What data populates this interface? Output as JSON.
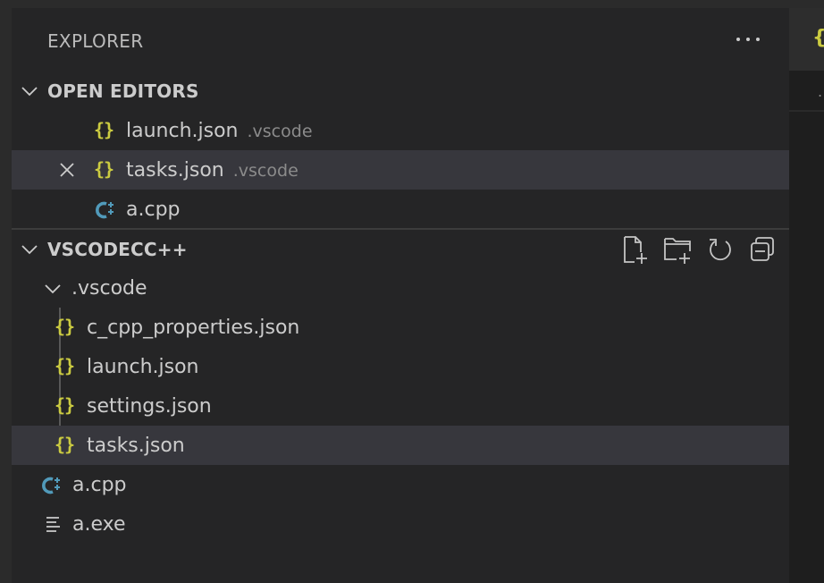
{
  "header": {
    "title": "EXPLORER",
    "more_icon": "ellipsis-icon"
  },
  "open_editors": {
    "title": "OPEN EDITORS",
    "items": [
      {
        "name": "launch.json",
        "desc": ".vscode",
        "icon": "json-icon",
        "icon_glyph": "{}",
        "selected": false
      },
      {
        "name": "tasks.json",
        "desc": ".vscode",
        "icon": "json-icon",
        "icon_glyph": "{}",
        "selected": true
      },
      {
        "name": "a.cpp",
        "desc": "",
        "icon": "cpp-icon",
        "selected": false
      }
    ]
  },
  "workspace": {
    "title": "VSCODECC++",
    "actions": [
      "new-file-icon",
      "new-folder-icon",
      "refresh-icon",
      "collapse-all-icon"
    ],
    "folder": {
      "name": ".vscode",
      "children": [
        {
          "name": "c_cpp_properties.json",
          "icon_glyph": "{}"
        },
        {
          "name": "launch.json",
          "icon_glyph": "{}"
        },
        {
          "name": "settings.json",
          "icon_glyph": "{}"
        },
        {
          "name": "tasks.json",
          "icon_glyph": "{}",
          "selected": true
        }
      ]
    },
    "files": [
      {
        "name": "a.cpp",
        "icon": "cpp-icon"
      },
      {
        "name": "a.exe",
        "icon": "exe-icon"
      }
    ]
  },
  "editor": {
    "tab_icon_glyph": "{",
    "breadcrumb_glyph": "."
  },
  "colors": {
    "sidebar_bg": "#252526",
    "selected_bg": "#37373d",
    "json_icon": "#cbcb41",
    "cpp_icon": "#519aba",
    "text": "#cccccc",
    "desc": "#8b8b8b"
  }
}
